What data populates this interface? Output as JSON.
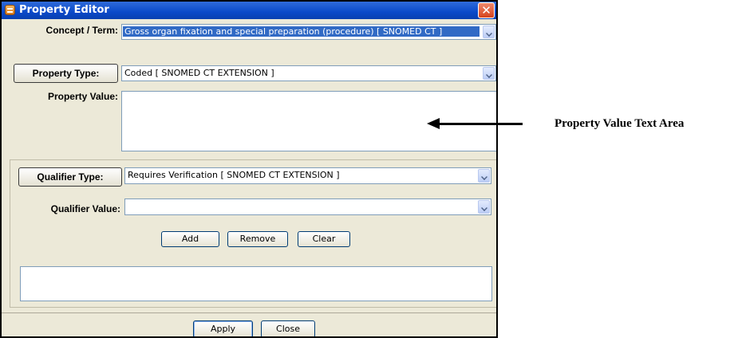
{
  "window": {
    "title": "Property Editor",
    "close_glyph": "✕"
  },
  "concept": {
    "label": "Concept / Term:",
    "value": "Gross organ fixation and special preparation (procedure) [ SNOMED CT ]"
  },
  "property_type": {
    "button_label": "Property Type:",
    "value": "Coded [ SNOMED CT EXTENSION ]"
  },
  "property_value": {
    "label": "Property Value:",
    "text": ""
  },
  "qualifier": {
    "type_button_label": "Qualifier Type:",
    "type_value": "Requires Verification [ SNOMED CT EXTENSION ]",
    "value_label": "Qualifier Value:",
    "value_value": "",
    "add_label": "Add",
    "remove_label": "Remove",
    "clear_label": "Clear",
    "list_text": ""
  },
  "footer": {
    "apply_label": "Apply",
    "close_label": "Close"
  },
  "annotation": {
    "text": "Property Value Text Area"
  },
  "colors": {
    "titlebar": "#0a49c9",
    "selection": "#316ac5",
    "window_bg": "#ece9d8"
  }
}
